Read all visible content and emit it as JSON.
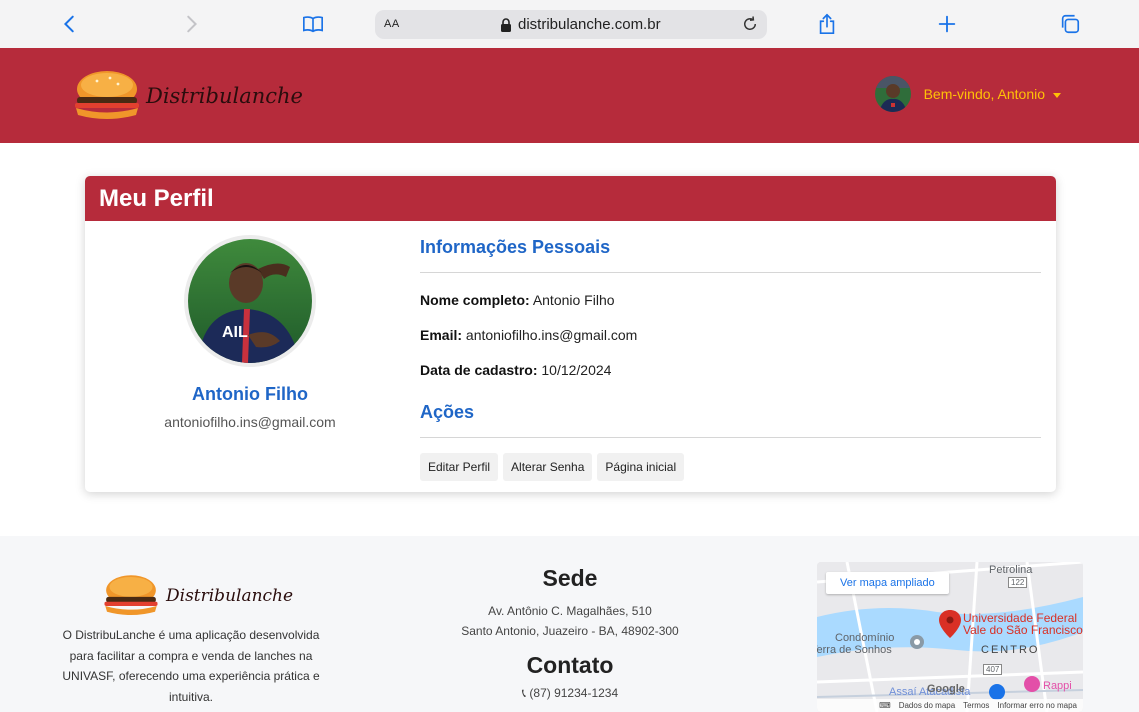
{
  "browser": {
    "aa_label": "AA",
    "url": "distribulanche.com.br"
  },
  "navbar": {
    "brand": "Distribulanche",
    "welcome": "Bem-vindo, Antonio"
  },
  "profile": {
    "card_title": "Meu Perfil",
    "name": "Antonio Filho",
    "email": "antoniofilho.ins@gmail.com",
    "personal_title": "Informações Pessoais",
    "fullname_label": "Nome completo:",
    "fullname_value": "Antonio Filho",
    "email_label": "Email:",
    "email_value": "antoniofilho.ins@gmail.com",
    "date_label": "Data de cadastro:",
    "date_value": "10/12/2024",
    "actions_title": "Ações",
    "edit_button": "Editar Perfil",
    "password_button": "Alterar Senha",
    "home_button": "Página inicial"
  },
  "footer": {
    "brand": "Distribulanche",
    "description": "O DistribuLanche é uma aplicação desenvolvida para facilitar a compra e venda de lanches na UNIVASF, oferecendo uma experiência prática e intuitiva.",
    "sede_title": "Sede",
    "address_line1": "Av. Antônio C. Magalhães, 510",
    "address_line2": "Santo Antonio, Juazeiro - BA, 48902-300",
    "contato_title": "Contato",
    "phone": "(87) 91234-1234"
  },
  "map": {
    "expand_link": "Ver mapa ampliado",
    "labels": {
      "petrolina": "Petrolina",
      "road_122": "122",
      "univ1": "Universidade Federal",
      "univ2": "Vale do São Francisco",
      "condominio": "Condomínio",
      "terra": "Terra de Sonhos",
      "centro": "CENTRO",
      "road_407": "407",
      "assai": "Assaí Atacadista",
      "rappi": "Rappi",
      "google": "Google"
    },
    "footer": {
      "shortcuts": "Dados do mapa",
      "terms": "Termos",
      "report": "Informar erro no mapa"
    }
  },
  "colors": {
    "brand_red": "#b62b3b",
    "welcome_yellow": "#ffc107",
    "link_blue": "#1f66c7"
  }
}
